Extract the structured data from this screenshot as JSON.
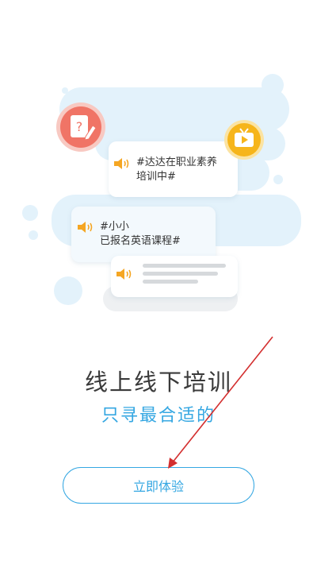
{
  "illustration": {
    "card1_text": "#达达在职业素养\n培训中#",
    "card2_text": "#小小\n已报名英语课程#",
    "question_icon": "question-note-icon",
    "tv_icon": "tv-play-icon",
    "speaker_icon": "speaker-icon"
  },
  "intro": {
    "title": "线上线下培训",
    "subtitle": "只寻最合适的"
  },
  "cta": {
    "label": "立即体验"
  },
  "colors": {
    "accent": "#35a7e2",
    "badge_red": "#f07466",
    "badge_yellow": "#f6b51b",
    "speaker": "#f5a623",
    "arrow": "#d32f2f"
  }
}
